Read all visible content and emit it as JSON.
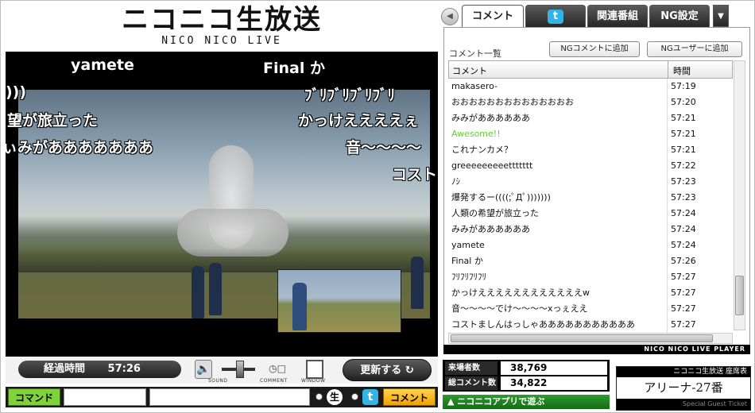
{
  "logo": {
    "title": "ニコニコ生放送",
    "subtitle": "NICO NICO LIVE"
  },
  "video": {
    "danmaku": [
      {
        "text": "yamete"
      },
      {
        "text": "Final か"
      },
      {
        "text": ")))"
      },
      {
        "text": "ﾌﾞﾘﾌﾞﾘﾌﾞﾘﾌﾞﾘ"
      },
      {
        "text": "望が旅立った"
      },
      {
        "text": "かっけええええぇ"
      },
      {
        "text": "ぃみがあああああああ"
      },
      {
        "text": "音～～～～"
      },
      {
        "text": "コスト"
      }
    ]
  },
  "controls": {
    "elapsed_label": "経過時間",
    "elapsed_time": "57:26",
    "sound_label": "SOUND",
    "comment_label": "COMMENT",
    "window_label": "WINDOW",
    "refresh_label": "更新する"
  },
  "command_bar": {
    "command_label": "コマンド",
    "submit_label": "コメント",
    "nama_icon": "生",
    "twitter_icon": "t"
  },
  "tabs": {
    "items": [
      {
        "label": "コメント"
      },
      {
        "label": "t"
      },
      {
        "label": "関連番組"
      },
      {
        "label": "NG設定"
      }
    ],
    "more": "▼",
    "prev": "◀"
  },
  "comment_panel": {
    "title": "コメント一覧",
    "ng_comment_button": "NGコメントに追加",
    "ng_user_button": "NGユーザーに追加",
    "col_comment": "コメント",
    "col_time": "時間",
    "highlight_color": "#66cc33",
    "rows": [
      {
        "comment": "makasero-",
        "time": "57:19"
      },
      {
        "comment": "おおおおおおおおおおおおおお",
        "time": "57:20"
      },
      {
        "comment": "みみがああああああ",
        "time": "57:21"
      },
      {
        "comment": "Awesome!!",
        "time": "57:21"
      },
      {
        "comment": "これナンカメ？",
        "time": "57:21"
      },
      {
        "comment": "greeeeeeeeettttttt",
        "time": "57:22"
      },
      {
        "comment": "ﾉｼ",
        "time": "57:23"
      },
      {
        "comment": "爆発するー((((;ﾟДﾟ)))))))",
        "time": "57:23"
      },
      {
        "comment": "人類の希望が旅立った",
        "time": "57:24"
      },
      {
        "comment": "みみがああああああ",
        "time": "57:24"
      },
      {
        "comment": "yamete",
        "time": "57:24"
      },
      {
        "comment": "Final か",
        "time": "57:26"
      },
      {
        "comment": "ﾌﾘﾌﾘﾌﾘﾌﾘ",
        "time": "57:27"
      },
      {
        "comment": "かっけええええええええええええw",
        "time": "57:27"
      },
      {
        "comment": "音～～～～でけ～～～～xっぇええ",
        "time": "57:27"
      },
      {
        "comment": "コストましんはっしゃあああああああああああ",
        "time": "57:27"
      }
    ]
  },
  "player_brand": "NICO NICO LIVE PLAYER",
  "stats": {
    "visitors_label": "来場者数",
    "visitors": "38,769",
    "comments_label": "総コメント数",
    "comments": "34,822"
  },
  "app_link": "ニコニコアプリで遊ぶ",
  "ticket": {
    "header": "ニコニコ生放送 座席表",
    "seat": "アリーナ-27番",
    "footer": "Special Guest Ticket"
  }
}
